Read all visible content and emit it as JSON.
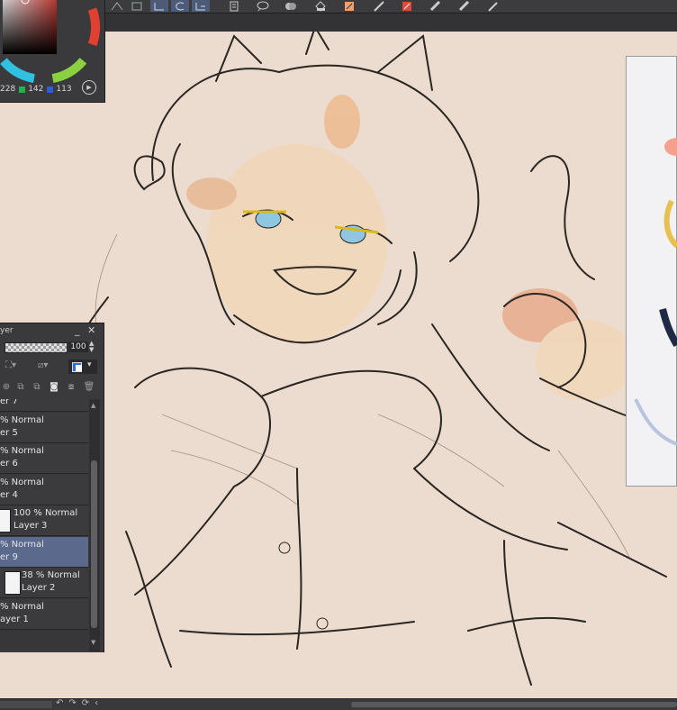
{
  "color_panel": {
    "r_value": "228",
    "g_value": "142",
    "b_value": "113",
    "swatch_colors": {
      "r": "#e0443c",
      "g": "#22b14c",
      "b": "#2f5be0"
    }
  },
  "layer_panel": {
    "title": "yer",
    "opacity_value": "100",
    "layers": [
      {
        "mode": "",
        "name": "er 7",
        "thumb": false,
        "selected": false
      },
      {
        "mode": "% Normal",
        "name": "er 5",
        "thumb": false,
        "selected": false
      },
      {
        "mode": "% Normal",
        "name": "er 6",
        "thumb": false,
        "selected": false
      },
      {
        "mode": "% Normal",
        "name": "er 4",
        "thumb": false,
        "selected": false
      },
      {
        "mode": "100 % Normal",
        "name": "Layer 3",
        "thumb": true,
        "selected": false
      },
      {
        "mode": "% Normal",
        "name": "er 9",
        "thumb": false,
        "selected": true
      },
      {
        "mode": "38 % Normal",
        "name": "Layer 2",
        "thumb": true,
        "selected": false
      },
      {
        "mode": "% Normal",
        "name": "ayer 1",
        "thumb": false,
        "selected": false
      }
    ]
  },
  "toolbar": {
    "icons": [
      "lasso-icon",
      "square-icon",
      "select-rect-icon",
      "select-ellipse-icon",
      "select-lasso-icon",
      "layer-icon",
      "speech-icon",
      "cloud-icon",
      "bucket-icon",
      "eraser-icon",
      "pen-icon",
      "brush-icon",
      "ruler-icon",
      "ruler2-icon",
      "pencil-icon"
    ]
  },
  "colors": {
    "canvas_bg": "#ecdccf",
    "panel_bg": "#3a3a3d",
    "selected_layer": "#5b6a8c",
    "accent": "#4d5b78"
  }
}
